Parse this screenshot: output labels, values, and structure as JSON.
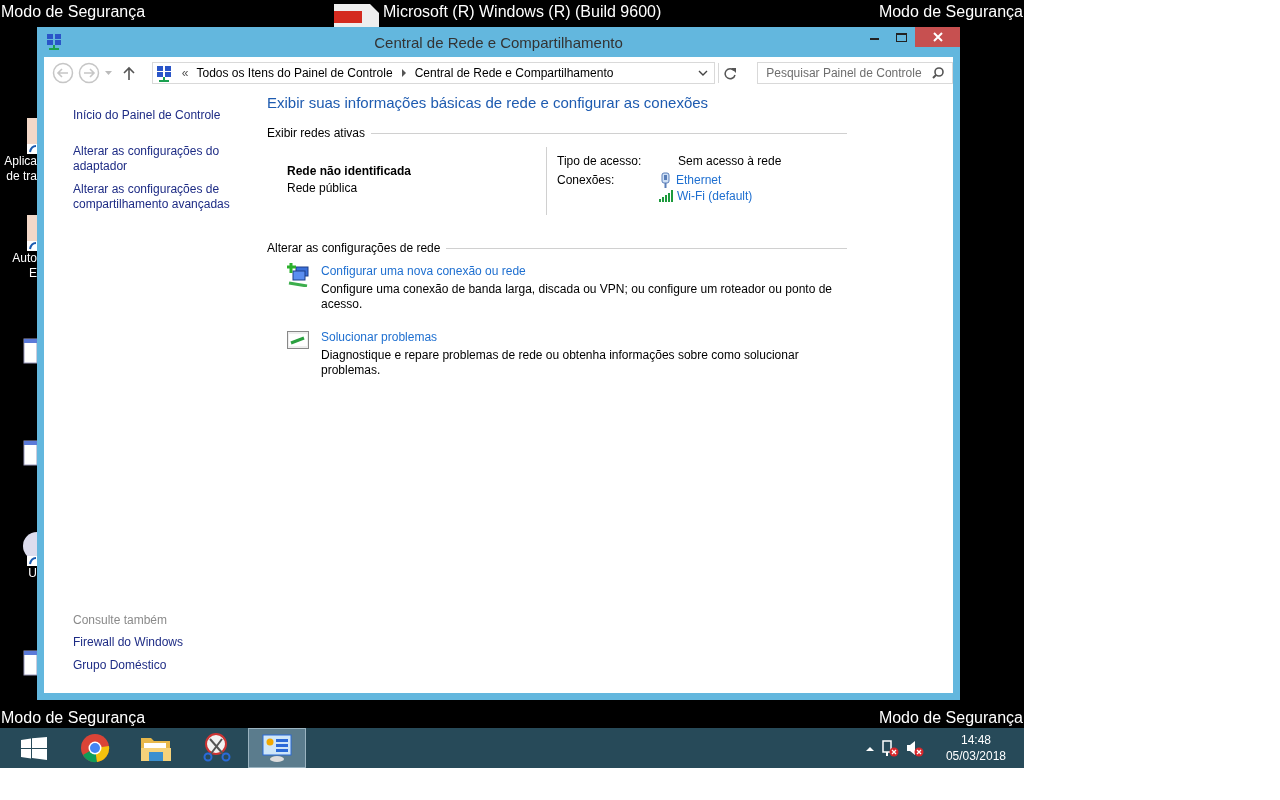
{
  "desktop": {
    "overlay_labels": [
      "Modo de Segurança",
      "Modo de Segurança",
      "Modo de Segurança",
      "Modo de Segurança"
    ],
    "build_label": "Microsoft (R) Windows (R) (Build 9600)",
    "icons": [
      {
        "kind": "shortcut",
        "lines": [
          "Aplica",
          "de tra"
        ]
      },
      {
        "kind": "shortcut",
        "lines": [
          "Auto",
          "E"
        ]
      },
      {
        "kind": "window"
      },
      {
        "kind": "window"
      },
      {
        "kind": "disc",
        "lines": [
          "U"
        ]
      },
      {
        "kind": "window"
      }
    ]
  },
  "window": {
    "title": "Central de Rede e Compartilhamento",
    "nav": {
      "back": {
        "disabled": true
      },
      "forward": {
        "disabled": true
      }
    },
    "address": {
      "overflow": "«",
      "crumbs": [
        "Todos os Itens do Painel de Controle",
        "Central de Rede e Compartilhamento"
      ]
    },
    "search": {
      "placeholder": "Pesquisar Painel de Controle"
    },
    "sidebar": {
      "links": [
        [
          "Início do Painel de Controle"
        ],
        [
          "Alterar as configurações do",
          "adaptador"
        ],
        [
          "Alterar as configurações de",
          "compartilhamento avançadas"
        ]
      ],
      "see_also_title": "Consulte também",
      "see_also": [
        "Firewall do Windows",
        "Grupo Doméstico"
      ]
    },
    "heading": "Exibir suas informações básicas de rede e configurar as conexões",
    "active_networks": {
      "title": "Exibir redes ativas",
      "name": "Rede não identificada",
      "category": "Rede pública",
      "rows": [
        {
          "label": "Tipo de acesso:",
          "values": [
            {
              "kind": "plain",
              "text": "Sem acesso à rede"
            }
          ]
        },
        {
          "label": "Conexões:",
          "values": [
            {
              "kind": "ethernet",
              "text": "Ethernet"
            },
            {
              "kind": "wifi",
              "text": "Wi-Fi (default)"
            }
          ]
        }
      ]
    },
    "change_settings": {
      "title": "Alterar as configurações de rede",
      "items": [
        {
          "kind": "new-connection",
          "title": "Configurar uma nova conexão ou rede",
          "description": "Configure uma conexão de banda larga, discada ou VPN; ou configure um roteador ou ponto de acesso."
        },
        {
          "kind": "troubleshoot",
          "title": "Solucionar problemas",
          "description": "Diagnostique e repare problemas de rede ou obtenha informações sobre como solucionar problemas."
        }
      ]
    }
  },
  "taskbar": {
    "apps": [
      {
        "kind": "start",
        "active": false
      },
      {
        "kind": "browser",
        "active": false
      },
      {
        "kind": "folder",
        "active": false
      },
      {
        "kind": "scissors",
        "active": false
      },
      {
        "kind": "control-panel",
        "active": true
      }
    ],
    "time": "14:48",
    "date": "05/03/2018"
  }
}
